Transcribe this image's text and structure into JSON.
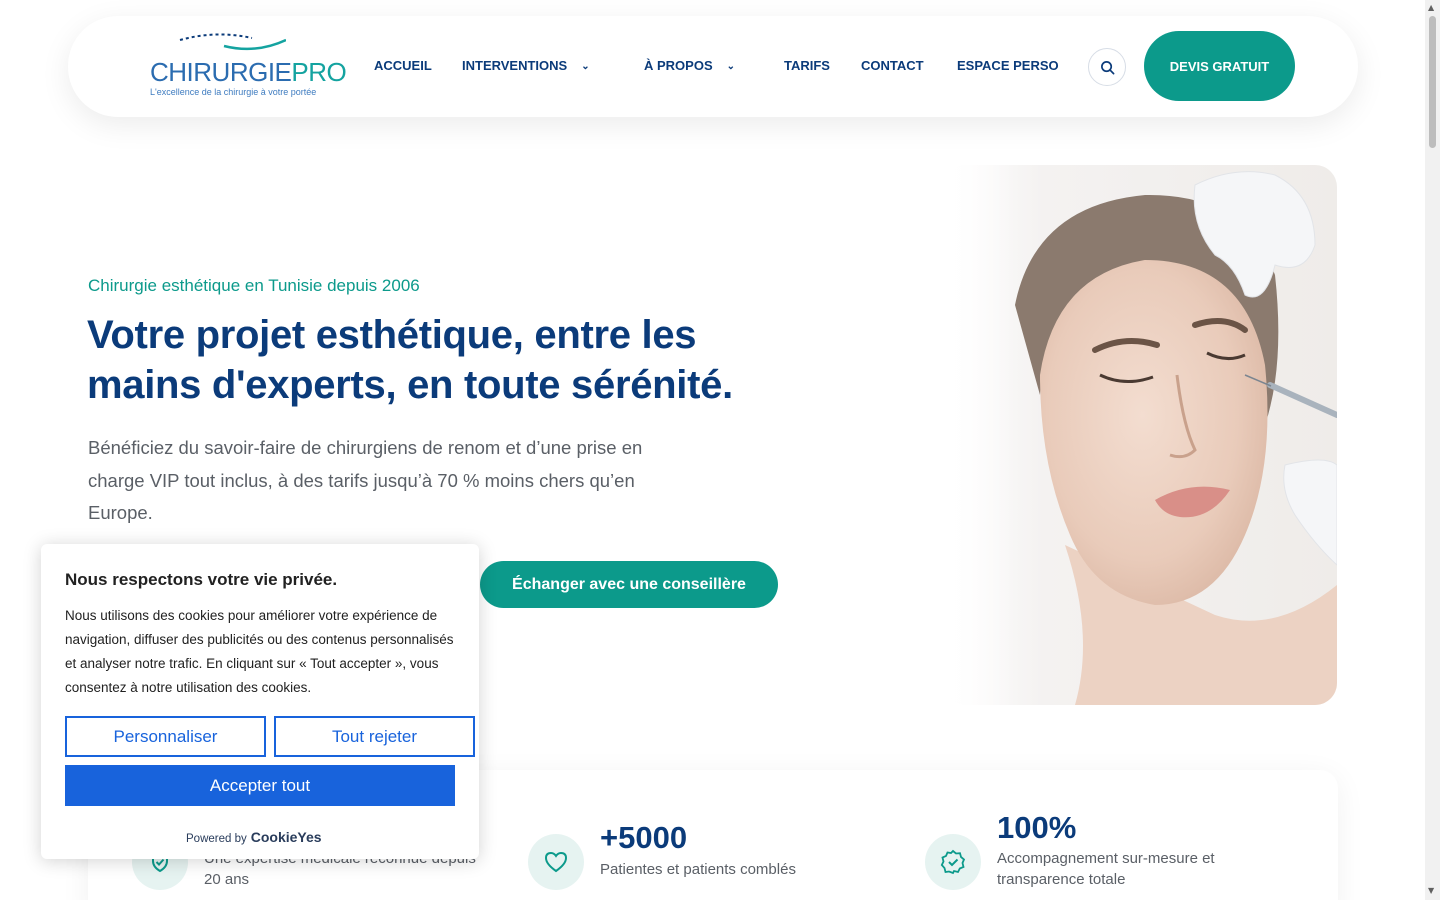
{
  "header": {
    "logo_main": "CHIRURGIE",
    "logo_accent": "PRO",
    "logo_tagline": "L'excellence de la chirurgie à votre portée",
    "nav": [
      {
        "label": "ACCUEIL"
      },
      {
        "label": "INTERVENTIONS"
      },
      {
        "label": "À PROPOS"
      },
      {
        "label": "TARIFS"
      },
      {
        "label": "CONTACT"
      },
      {
        "label": "ESPACE PERSO"
      }
    ],
    "cta_label": "DEVIS GRATUIT"
  },
  "hero": {
    "eyebrow": "Chirurgie esthétique en Tunisie depuis 2006",
    "title": "Votre projet esthétique, entre les mains d'experts, en toute sérénité.",
    "description": "Bénéficiez du savoir-faire de chirurgiens de renom et d’une prise en charge VIP tout inclus, à des tarifs jusqu’à 70 % moins chers qu’en Europe.",
    "cta_label": "Échanger avec une conseillère"
  },
  "stats": [
    {
      "icon": "shield-check-icon",
      "value": "",
      "label": "Une expertise médicale reconnue depuis 20 ans"
    },
    {
      "icon": "heart-icon",
      "value": "+5000",
      "label": "Patientes et patients comblés"
    },
    {
      "icon": "badge-check-icon",
      "value": "100%",
      "label": "Accompagnement sur-mesure et transparence totale"
    }
  ],
  "cookie_banner": {
    "title": "Nous respectons votre vie privée.",
    "text": "Nous utilisons des cookies pour améliorer votre expérience de navigation, diffuser des publicités ou des contenus personnalisés et analyser notre trafic. En cliquant sur « Tout accepter », vous consentez à notre utilisation des cookies.",
    "customize_label": "Personnaliser",
    "reject_label": "Tout rejeter",
    "accept_label": "Accepter tout",
    "powered_by": "Powered by",
    "brand": "CookieYes"
  },
  "colors": {
    "primary_navy": "#0b3b7a",
    "teal": "#0c9a8b",
    "cookie_blue": "#1863dc"
  }
}
